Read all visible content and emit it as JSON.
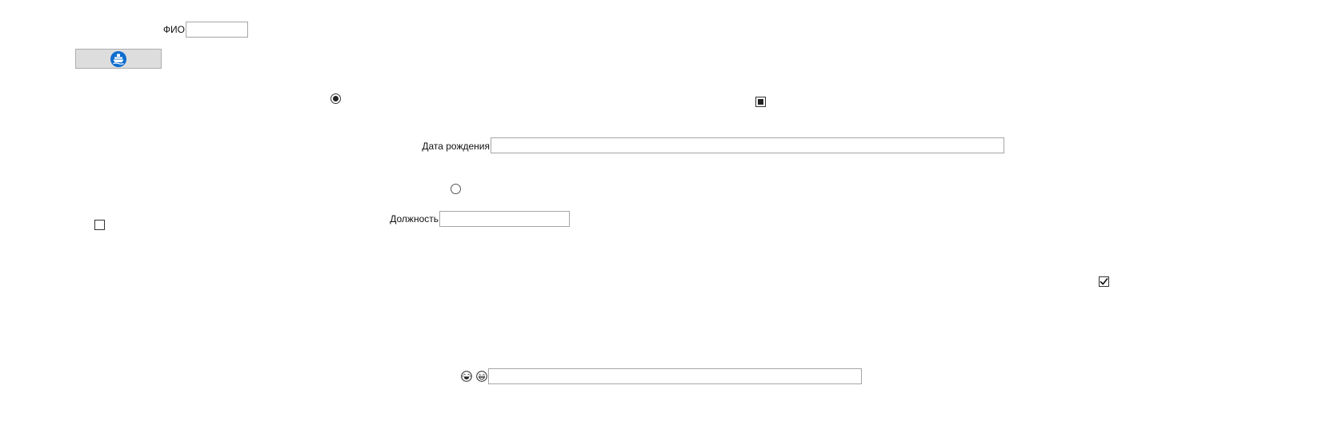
{
  "form": {
    "fio_label": "ФИО",
    "fio_value": "",
    "birth_label": "Дата рождения",
    "birth_value": "",
    "position_label": "Должность",
    "position_value": "",
    "extra_value": ""
  },
  "controls": {
    "radio_top": {
      "checked": true
    },
    "radio_middle": {
      "checked": false
    },
    "check_indeterminate": {
      "state": "indeterminate"
    },
    "check_left": {
      "state": "unchecked"
    },
    "check_right": {
      "state": "checked"
    }
  },
  "icons": {
    "button_icon": "ship-icon",
    "emoji_1": "laughing-face-icon",
    "emoji_2": "grinning-face-icon"
  },
  "colors": {
    "accent": "#0d6dd0",
    "button_bg": "#dddddd",
    "border": "#a6a6a6"
  }
}
